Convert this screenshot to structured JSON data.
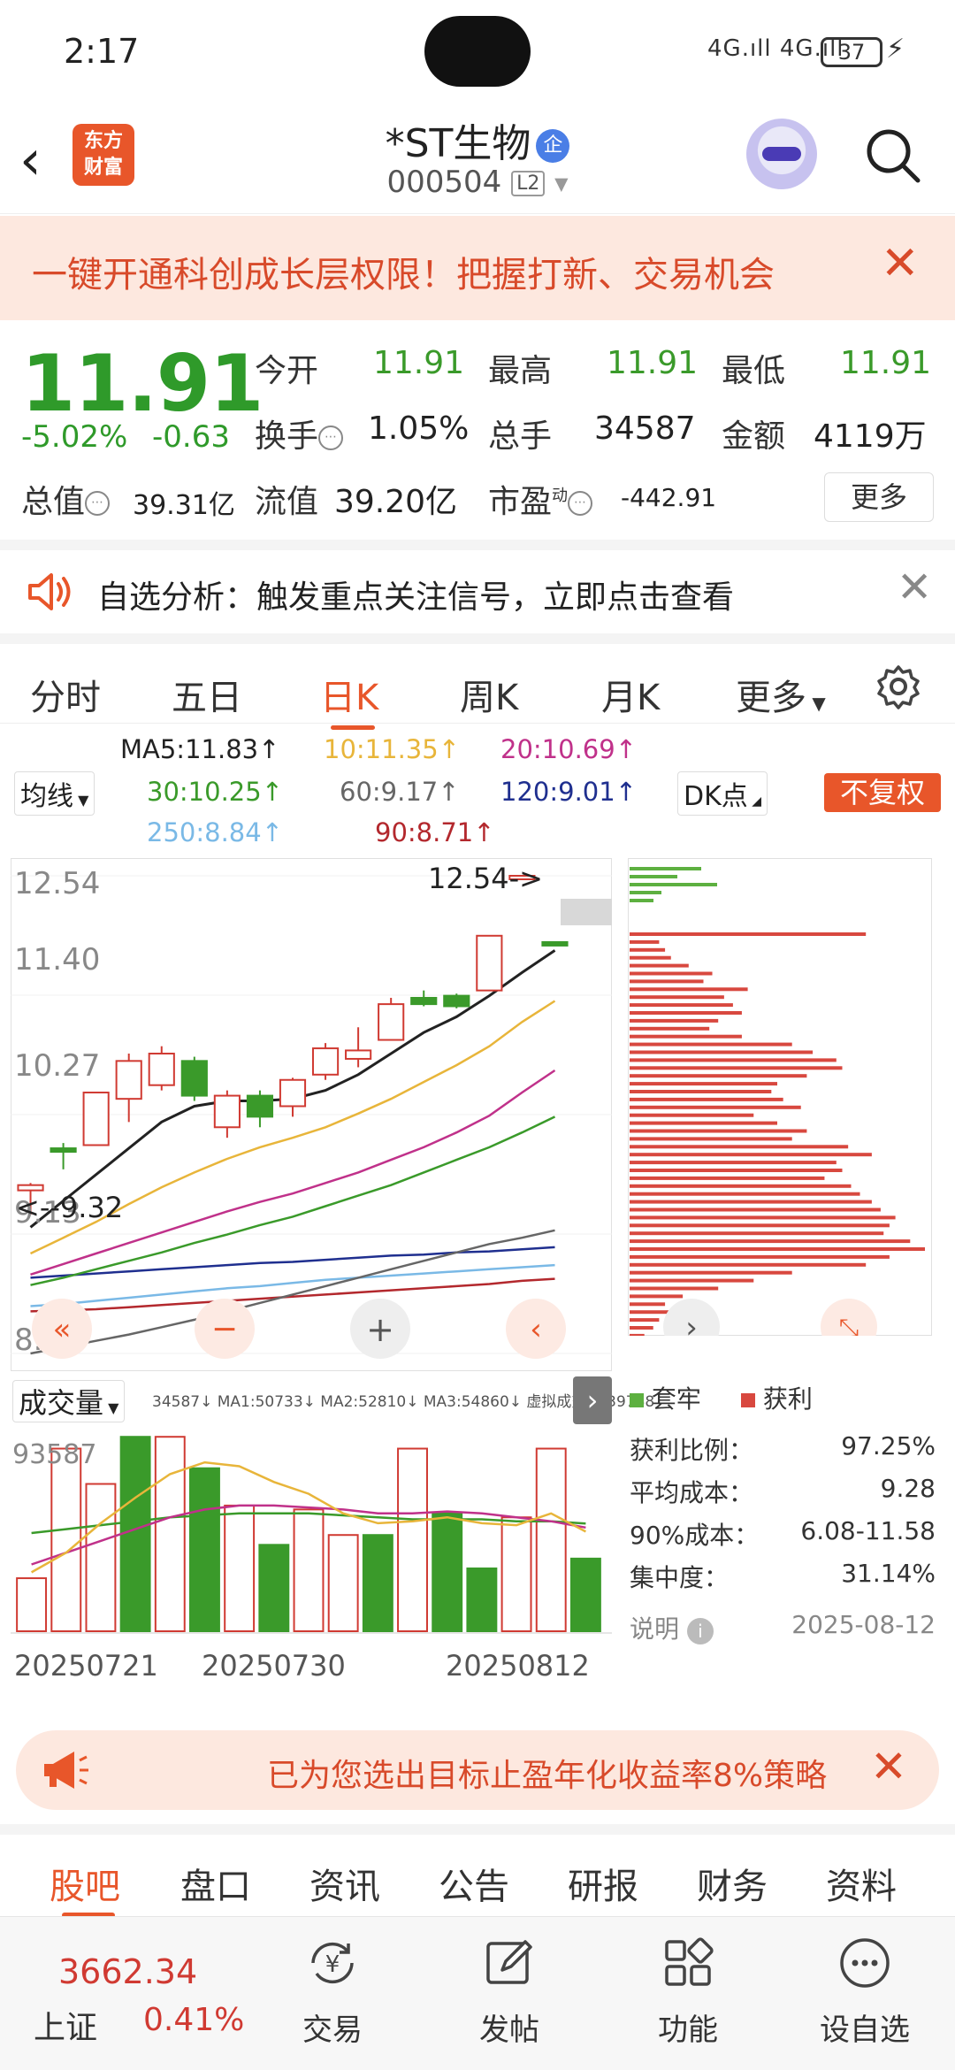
{
  "status": {
    "time": "2:17",
    "signal": "4G.ıll 4G.ıll",
    "battery": "37"
  },
  "header": {
    "logo_line1": "东方",
    "logo_line2": "财富",
    "name": "*ST生物",
    "badge": "企",
    "code": "000504",
    "level": "L2"
  },
  "promo": {
    "text": "一键开通科创成长层权限！把握打新、交易机会",
    "close": "✕"
  },
  "quote": {
    "price": "11.91",
    "change_pct": "-5.02%",
    "change": "-0.63",
    "open_label": "今开",
    "open": "11.91",
    "high_label": "最高",
    "high": "11.91",
    "low_label": "最低",
    "low": "11.91",
    "turnover_label": "换手",
    "turnover": "1.05%",
    "volume_label": "总手",
    "volume": "34587",
    "amount_label": "金额",
    "amount": "4119万",
    "mktcap_label": "总值",
    "mktcap": "39.31亿",
    "float_label": "流值",
    "float": "39.20亿",
    "pe_label": "市盈",
    "pe_sup": "动",
    "pe": "-442.91",
    "more": "更多"
  },
  "analysis": {
    "text": "自选分析：触发重点关注信号，立即点击查看",
    "close": "✕"
  },
  "periods": {
    "tabs": [
      "分时",
      "五日",
      "日K",
      "周K",
      "月K",
      "更多"
    ],
    "active": "日K"
  },
  "ma_legend": {
    "select": "均线",
    "ma5": "MA5:11.83↑",
    "ma10": "10:11.35↑",
    "ma20": "20:10.69↑",
    "ma30": "30:10.25↑",
    "ma60": "60:9.17↑",
    "ma120": "120:9.01↑",
    "ma250": "250:8.84↑",
    "ma90": "90:8.71↑",
    "dk": "DK点",
    "adjust": "不复权",
    "colors": {
      "ma5": "#222222",
      "ma10": "#e8b53a",
      "ma20": "#c0318a",
      "ma30": "#3a9a2a",
      "ma60": "#666666",
      "ma120": "#1f2f8f",
      "ma250": "#7ab9e6",
      "ma90": "#b3282d"
    }
  },
  "chart_data": {
    "type": "candlestick",
    "y_ticks": [
      "12.54",
      "11.40",
      "10.27",
      "9.13",
      "8.00"
    ],
    "ylim": [
      8.0,
      12.54
    ],
    "high_marker": "12.54->",
    "low_marker": "<--9.32",
    "candles": [
      {
        "o": 9.55,
        "c": 9.6,
        "h": 9.62,
        "l": 9.32
      },
      {
        "o": 9.95,
        "c": 9.95,
        "h": 10.0,
        "l": 9.75
      },
      {
        "o": 9.98,
        "c": 10.48,
        "h": 10.48,
        "l": 9.98
      },
      {
        "o": 10.78,
        "c": 10.42,
        "h": 10.85,
        "l": 10.2
      },
      {
        "o": 10.55,
        "c": 10.85,
        "h": 10.92,
        "l": 10.5
      },
      {
        "o": 10.78,
        "c": 10.45,
        "h": 10.82,
        "l": 10.4
      },
      {
        "o": 10.15,
        "c": 10.45,
        "h": 10.5,
        "l": 10.05
      },
      {
        "o": 10.45,
        "c": 10.25,
        "h": 10.5,
        "l": 10.15
      },
      {
        "o": 10.35,
        "c": 10.6,
        "h": 10.62,
        "l": 10.25
      },
      {
        "o": 10.65,
        "c": 10.9,
        "h": 10.95,
        "l": 10.6
      },
      {
        "o": 10.8,
        "c": 10.88,
        "h": 11.1,
        "l": 10.72
      },
      {
        "o": 10.98,
        "c": 11.32,
        "h": 11.38,
        "l": 10.98
      },
      {
        "o": 11.38,
        "c": 11.32,
        "h": 11.45,
        "l": 11.3
      },
      {
        "o": 11.3,
        "c": 11.4,
        "h": 11.42,
        "l": 11.28
      },
      {
        "o": 11.45,
        "c": 11.97,
        "h": 11.97,
        "l": 11.45
      },
      {
        "o": 12.54,
        "c": 12.54,
        "h": 12.54,
        "l": 12.54
      },
      {
        "o": 11.91,
        "c": 11.91,
        "h": 11.91,
        "l": 11.91
      }
    ],
    "up_flags": [
      1,
      0,
      1,
      1,
      1,
      0,
      1,
      0,
      1,
      1,
      1,
      1,
      0,
      0,
      1,
      1,
      0
    ],
    "ma_lines": {
      "ma5": [
        9.2,
        9.45,
        9.7,
        9.95,
        10.2,
        10.35,
        10.4,
        10.4,
        10.42,
        10.5,
        10.65,
        10.85,
        11.05,
        11.2,
        11.4,
        11.62,
        11.83
      ],
      "ma10": [
        8.95,
        9.1,
        9.25,
        9.42,
        9.58,
        9.72,
        9.85,
        9.96,
        10.05,
        10.15,
        10.28,
        10.42,
        10.58,
        10.74,
        10.92,
        11.15,
        11.35
      ],
      "ma20": [
        8.75,
        8.85,
        8.95,
        9.05,
        9.15,
        9.25,
        9.35,
        9.44,
        9.52,
        9.62,
        9.72,
        9.84,
        9.96,
        10.1,
        10.26,
        10.48,
        10.69
      ],
      "ma30": [
        8.65,
        8.72,
        8.8,
        8.88,
        8.96,
        9.05,
        9.13,
        9.22,
        9.3,
        9.4,
        9.5,
        9.6,
        9.72,
        9.84,
        9.96,
        10.1,
        10.25
      ],
      "ma60": [
        8.0,
        8.06,
        8.12,
        8.18,
        8.25,
        8.32,
        8.4,
        8.48,
        8.56,
        8.64,
        8.72,
        8.8,
        8.88,
        8.96,
        9.04,
        9.1,
        9.17
      ],
      "ma120": [
        8.72,
        8.74,
        8.76,
        8.78,
        8.8,
        8.82,
        8.84,
        8.86,
        8.87,
        8.89,
        8.91,
        8.93,
        8.94,
        8.96,
        8.97,
        8.99,
        9.01
      ],
      "ma250": [
        8.45,
        8.47,
        8.5,
        8.53,
        8.56,
        8.59,
        8.62,
        8.64,
        8.67,
        8.7,
        8.72,
        8.74,
        8.76,
        8.78,
        8.8,
        8.82,
        8.84
      ],
      "ma90": [
        8.4,
        8.41,
        8.42,
        8.44,
        8.46,
        8.48,
        8.5,
        8.52,
        8.54,
        8.56,
        8.58,
        8.6,
        8.62,
        8.64,
        8.66,
        8.69,
        8.71
      ]
    },
    "volume": {
      "select": "成交量",
      "legend": "34587↓ MA1:50733↓ MA2:52810↓ MA3:54860↓ 虚拟成交量:39788",
      "ymax_label": "93587",
      "ymax": 100000,
      "values": [
        27000,
        93000,
        75000,
        99000,
        99000,
        83000,
        64000,
        44000,
        62000,
        49000,
        49000,
        93000,
        60000,
        32000,
        58000,
        93000,
        37000
      ],
      "up_flags": [
        1,
        1,
        1,
        0,
        1,
        0,
        1,
        0,
        1,
        1,
        0,
        1,
        0,
        0,
        1,
        1,
        0
      ],
      "ma1": [
        30000,
        40000,
        55000,
        68000,
        80000,
        86000,
        84000,
        76000,
        70000,
        60000,
        55000,
        56000,
        58000,
        55000,
        54000,
        60000,
        50733
      ],
      "ma2": [
        34000,
        40000,
        46000,
        52000,
        58000,
        62000,
        64000,
        64000,
        63000,
        62000,
        60000,
        60000,
        61000,
        60000,
        58000,
        56000,
        52810
      ],
      "ma3": [
        50000,
        52000,
        54000,
        56000,
        58000,
        59000,
        60000,
        60000,
        60000,
        59000,
        58000,
        57000,
        57000,
        57000,
        56000,
        56000,
        54860
      ],
      "colors": {
        "ma1": "#e8b53a",
        "ma2": "#c0318a",
        "ma3": "#3a9a2a"
      }
    },
    "x_labels": [
      "20250721",
      "20250730",
      "20250812"
    ],
    "up_color": "#d03a32",
    "down_color": "#3a9a2a"
  },
  "chip": {
    "legend_trapped": "套牢",
    "legend_profit": "获利",
    "profit_ratio_label": "获利比例：",
    "profit_ratio": "97.25%",
    "avg_cost_label": "平均成本：",
    "avg_cost": "9.28",
    "cost90_label": "90%成本：",
    "cost90": "6.08-11.58",
    "concentration_label": "集中度：",
    "concentration": "31.14%",
    "note_label": "说明",
    "date": "2025-08-12",
    "bars_green": [
      0.45,
      0.3,
      0.55,
      0.2,
      0.15
    ],
    "bars_red": [
      0.8,
      0.1,
      0.12,
      0.14,
      0.2,
      0.28,
      0.25,
      0.4,
      0.32,
      0.35,
      0.38,
      0.3,
      0.27,
      0.38,
      0.55,
      0.62,
      0.7,
      0.72,
      0.6,
      0.5,
      0.48,
      0.52,
      0.58,
      0.42,
      0.5,
      0.6,
      0.55,
      0.74,
      0.82,
      0.7,
      0.72,
      0.66,
      0.75,
      0.78,
      0.82,
      0.85,
      0.9,
      0.88,
      0.86,
      0.95,
      1.0,
      0.88,
      0.8,
      0.55,
      0.42,
      0.3,
      0.18,
      0.12,
      0.2,
      0.1,
      0.08,
      0.05
    ],
    "green_color": "#5db040",
    "red_color": "#d8483f"
  },
  "ad": {
    "text": "已为您选出目标止盈年化收益率8%策略",
    "close": "✕"
  },
  "bottom_tabs": {
    "items": [
      "股吧",
      "盘口",
      "资讯",
      "公告",
      "研报",
      "财务",
      "资料"
    ],
    "active": "股吧"
  },
  "nav": {
    "index_value": "3662.34",
    "index_name": "上证",
    "index_pct": "0.41%",
    "items": [
      "交易",
      "发帖",
      "功能",
      "设自选"
    ]
  }
}
